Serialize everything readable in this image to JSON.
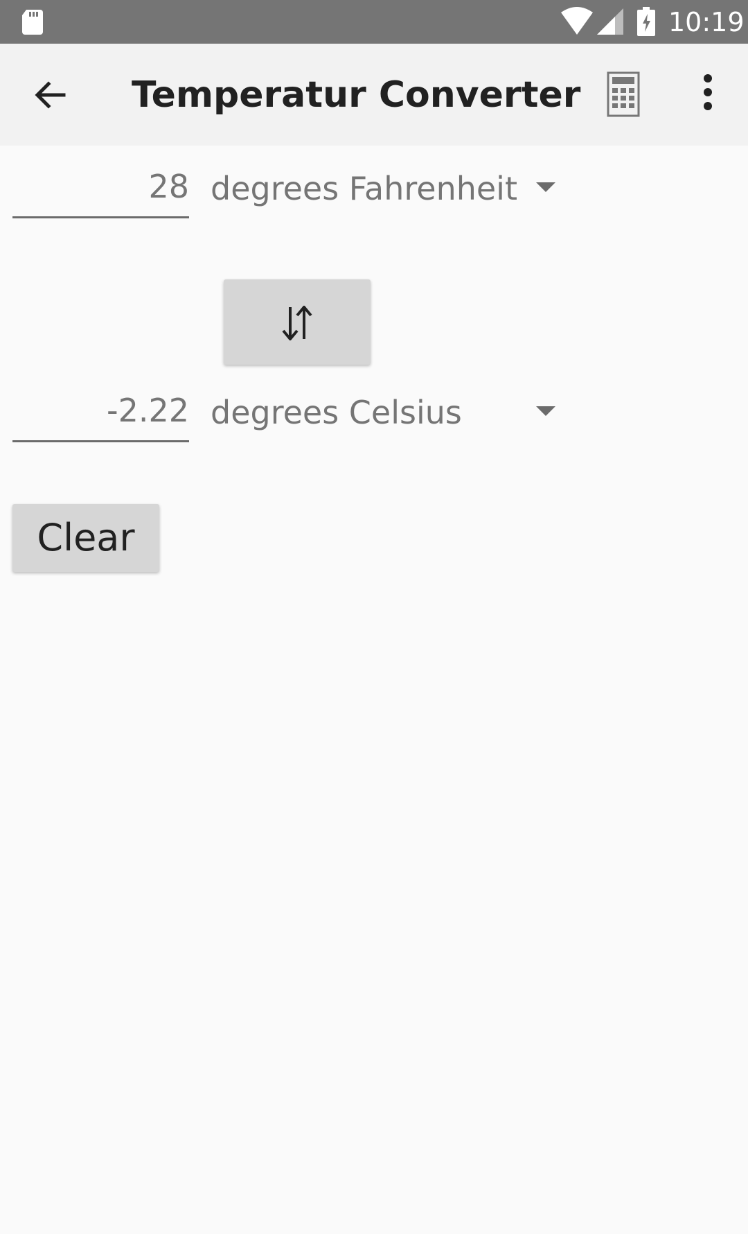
{
  "status_bar": {
    "time": "10:19",
    "icons": [
      "sd-card-icon",
      "wifi-icon",
      "signal-icon",
      "battery-charging-icon"
    ]
  },
  "app_bar": {
    "title": "Temperatur Converter",
    "icons": [
      "back-arrow-icon",
      "calculator-icon",
      "more-vert-icon"
    ]
  },
  "converter": {
    "from": {
      "value": "28",
      "unit": "degrees Fahrenheit"
    },
    "to": {
      "value": "-2.22",
      "unit": "degrees Celsius"
    },
    "swap_icon": "swap-vert-icon",
    "clear_label": "Clear"
  },
  "colors": {
    "status_bar": "#757575",
    "app_bar": "#f2f2f2",
    "background": "#fafafa",
    "button": "#d6d6d6"
  }
}
